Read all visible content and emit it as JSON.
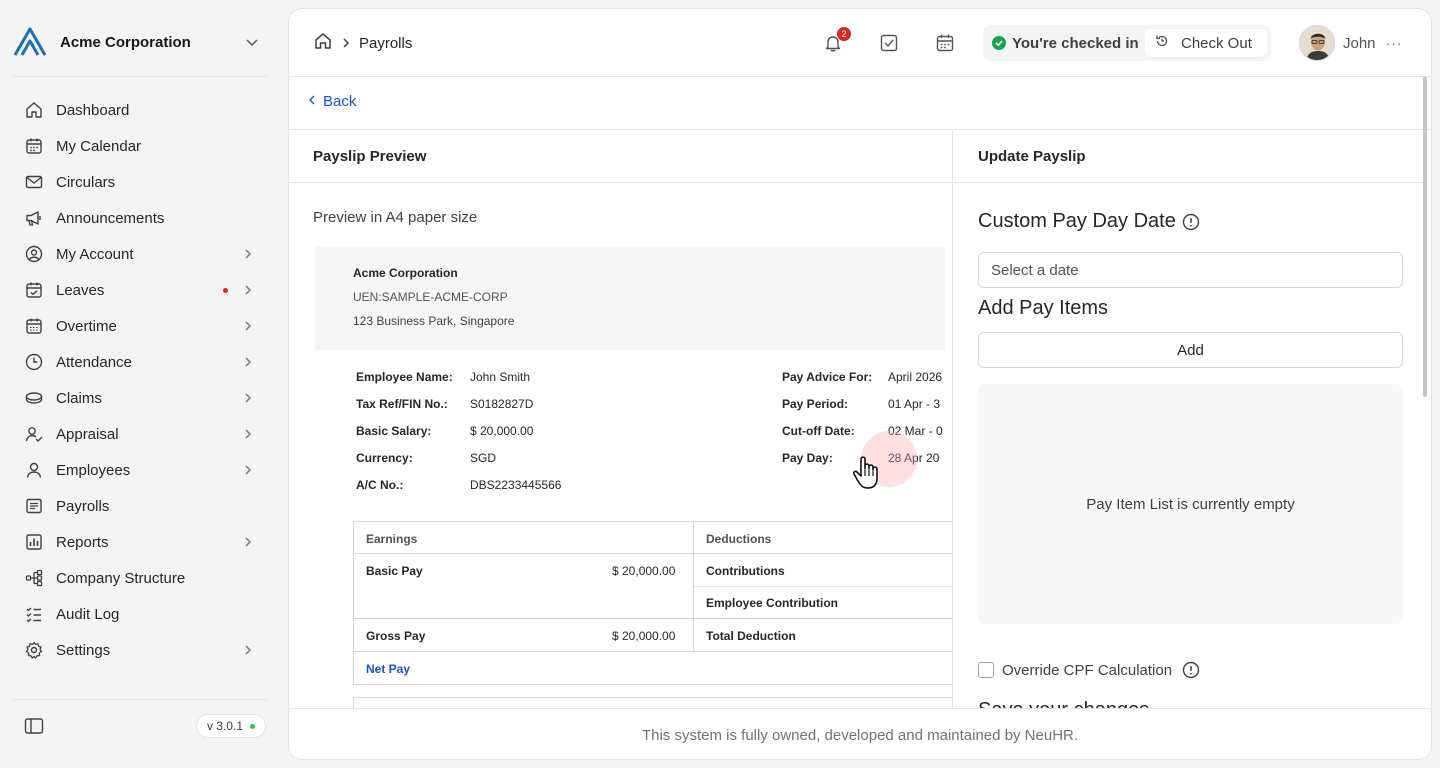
{
  "org": {
    "name": "Acme Corporation"
  },
  "sidebar": {
    "items": [
      {
        "label": "Dashboard",
        "icon": "home-icon",
        "has_children": false
      },
      {
        "label": "My Calendar",
        "icon": "calendar-icon",
        "has_children": false
      },
      {
        "label": "Circulars",
        "icon": "mail-icon",
        "has_children": false
      },
      {
        "label": "Announcements",
        "icon": "megaphone-icon",
        "has_children": false
      },
      {
        "label": "My Account",
        "icon": "user-circle-icon",
        "has_children": true
      },
      {
        "label": "Leaves",
        "icon": "calendar-check-icon",
        "has_children": true,
        "notification_dot": true
      },
      {
        "label": "Overtime",
        "icon": "calendar-grid-icon",
        "has_children": true
      },
      {
        "label": "Attendance",
        "icon": "clock-icon",
        "has_children": true
      },
      {
        "label": "Claims",
        "icon": "coins-icon",
        "has_children": true
      },
      {
        "label": "Appraisal",
        "icon": "user-check-icon",
        "has_children": true
      },
      {
        "label": "Employees",
        "icon": "user-icon",
        "has_children": true
      },
      {
        "label": "Payrolls",
        "icon": "receipt-icon",
        "has_children": false
      },
      {
        "label": "Reports",
        "icon": "chart-icon",
        "has_children": true
      },
      {
        "label": "Company Structure",
        "icon": "hierarchy-icon",
        "has_children": false
      },
      {
        "label": "Audit Log",
        "icon": "checklist-icon",
        "has_children": false
      },
      {
        "label": "Settings",
        "icon": "gear-icon",
        "has_children": true
      }
    ],
    "version": "v 3.0.1"
  },
  "header": {
    "breadcrumb": "Payrolls",
    "notifications_count": "2",
    "checkin_status": "You're checked in",
    "checkout_label": "Check Out",
    "user_name": "John",
    "more": "···"
  },
  "back_label": "Back",
  "preview": {
    "heading": "Payslip Preview",
    "paper_label": "Preview in A4 paper size",
    "company": {
      "name": "Acme Corporation",
      "uen": "UEN:SAMPLE-ACME-CORP",
      "address": "123 Business Park, Singapore"
    },
    "employee": {
      "name_label": "Employee Name:",
      "name": "John Smith",
      "tax_label": "Tax Ref/FIN No.:",
      "tax": "S0182827D",
      "salary_label": "Basic Salary:",
      "salary": "$ 20,000.00",
      "currency_label": "Currency:",
      "currency": "SGD",
      "ac_label": "A/C No.:",
      "ac": "DBS2233445566"
    },
    "pay": {
      "advice_label": "Pay Advice For:",
      "advice": "April 2026",
      "period_label": "Pay Period:",
      "period": "01 Apr - 3",
      "cutoff_label": "Cut-off Date:",
      "cutoff": "02 Mar - 0",
      "payday_label": "Pay Day:",
      "payday": "28 Apr 20"
    },
    "table": {
      "earnings_header": "Earnings",
      "deductions_header": "Deductions",
      "basic_pay_label": "Basic Pay",
      "basic_pay_value": "$ 20,000.00",
      "contributions_label": "Contributions",
      "employee_contribution_label": "Employee Contribution",
      "gross_pay_label": "Gross Pay",
      "gross_pay_value": "$ 20,000.00",
      "total_deduction_label": "Total Deduction",
      "net_pay_label": "Net Pay"
    }
  },
  "update": {
    "heading": "Update Payslip",
    "custom_date_title": "Custom Pay Day Date",
    "date_placeholder": "Select a date",
    "add_items_title": "Add Pay Items",
    "add_button": "Add",
    "empty_text": "Pay Item List is currently empty",
    "override_label": "Override CPF Calculation",
    "save_title": "Save your changes"
  },
  "footer_text": "This system is fully owned, developed and maintained by NeuHR.",
  "colors": {
    "accent": "#1d4ed8",
    "success": "#16a34a",
    "danger": "#dc2626",
    "logo": "#1e6fb8"
  }
}
